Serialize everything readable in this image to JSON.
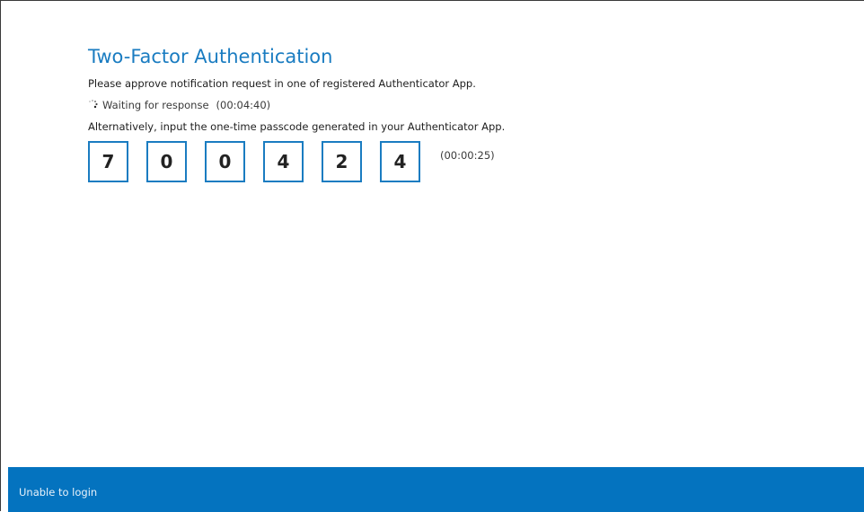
{
  "title": "Two-Factor Authentication",
  "instruction": "Please approve notification request in one of registered Authenticator App.",
  "waiting": {
    "icon": "spinner-icon",
    "text": "Waiting for response",
    "timer": "(00:04:40)"
  },
  "alternative_text": "Alternatively, input the one-time passcode generated in your Authenticator App.",
  "otp": {
    "digits": [
      "7",
      "0",
      "0",
      "4",
      "2",
      "4"
    ],
    "timer": "(00:00:25)",
    "accent": "#1a7cc1"
  },
  "footer": {
    "link_label": "Unable to login",
    "background": "#0473bf"
  }
}
